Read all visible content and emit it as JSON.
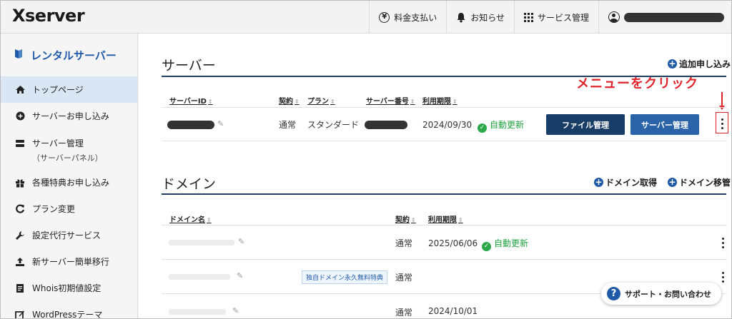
{
  "header": {
    "logo": "Xserver",
    "nav": [
      {
        "label": "料金支払い",
        "icon": "yen-icon"
      },
      {
        "label": "お知らせ",
        "icon": "bell-icon"
      },
      {
        "label": "サービス管理",
        "icon": "grid-icon"
      },
      {
        "label": "",
        "icon": "user-icon"
      }
    ]
  },
  "sidebar": {
    "title": "レンタルサーバー",
    "items": [
      {
        "label": "トップページ",
        "icon": "home-icon"
      },
      {
        "label": "サーバーお申し込み",
        "icon": "plus-circle-icon"
      },
      {
        "label": "サーバー管理",
        "sub": "（サーバーパネル）",
        "icon": "server-icon"
      },
      {
        "label": "各種特典お申し込み",
        "icon": "gift-icon"
      },
      {
        "label": "プラン変更",
        "icon": "refresh-icon"
      },
      {
        "label": "設定代行サービス",
        "icon": "wrench-icon"
      },
      {
        "label": "新サーバー簡単移行",
        "icon": "upload-icon"
      },
      {
        "label": "Whois初期値設定",
        "icon": "document-icon"
      },
      {
        "label": "WordPressテーマ",
        "icon": "edit-icon"
      }
    ]
  },
  "server_section": {
    "title": "サーバー",
    "add_label": "追加申し込み",
    "columns": [
      "サーバーID",
      "契約",
      "プラン",
      "サーバー番号",
      "利用期限"
    ],
    "row": {
      "contract": "通常",
      "plan": "スタンダード",
      "expiry": "2024/09/30",
      "auto_renew": "自動更新",
      "file_button": "ファイル管理",
      "server_button": "サーバー管理"
    }
  },
  "annotation": {
    "text": "メニューをクリック",
    "arrow": "↓"
  },
  "domain_section": {
    "title": "ドメイン",
    "get_label": "ドメイン取得",
    "transfer_label": "ドメイン移管",
    "columns": [
      "ドメイン名",
      "契約",
      "利用期限"
    ],
    "rows": [
      {
        "contract": "通常",
        "expiry": "2025/06/06",
        "auto_renew": "自動更新",
        "badge": ""
      },
      {
        "contract": "通常",
        "expiry": "",
        "auto_renew": "",
        "badge": "独自ドメイン永久無料特典"
      },
      {
        "contract": "通常",
        "expiry": "2024/10/01",
        "auto_renew": "",
        "badge": ""
      }
    ]
  },
  "support": {
    "label": "サポート・お問い合わせ"
  }
}
